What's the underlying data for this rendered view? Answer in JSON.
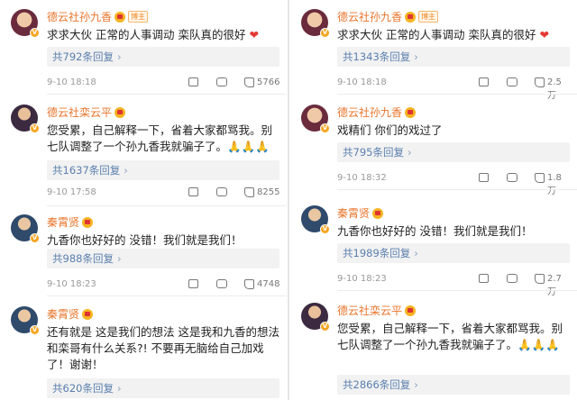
{
  "left": [
    {
      "name": "德云社孙九香",
      "badge": "博主",
      "text": "求求大伙 正常的人事调动 栾队真的很好",
      "emoji": "❤",
      "replies": "共792条回复",
      "time": "9-10 18:18",
      "likes": "5766"
    },
    {
      "name": "德云社栾云平",
      "text": "您受累，自己解释一下，省着大家都骂我。别七队调整了一个孙九香我就骗子了。🙏🙏🙏",
      "replies": "共1637条回复",
      "time": "9-10 17:58",
      "likes": "8255"
    },
    {
      "name": "秦霄贤",
      "text": "九香你也好好的   没错！我们就是我们！",
      "replies": "共988条回复",
      "time": "9-10 18:23",
      "likes": "4748"
    },
    {
      "name": "秦霄贤",
      "text": "还有就是 这是我们的想法   这是我和九香的想法   和栾哥有什么关系?! 不要再无脑给自己加戏了！谢谢！",
      "replies": "共620条回复"
    }
  ],
  "right": [
    {
      "name": "德云社孙九香",
      "badge": "博主",
      "text": "求求大伙 正常的人事调动 栾队真的很好",
      "emoji": "❤",
      "replies": "共1343条回复",
      "time": "9-10 18:18",
      "likes": "2.5万"
    },
    {
      "name": "德云社孙九香",
      "text": "戏精们 你们的戏过了",
      "replies": "共795条回复",
      "time": "9-10 18:32",
      "likes": "1.8万"
    },
    {
      "name": "秦霄贤",
      "text": "九香你也好好的   没错！我们就是我们！",
      "replies": "共1989条回复",
      "time": "9-10 18:23",
      "likes": "2.7万"
    },
    {
      "name": "德云社栾云平",
      "text": "您受累，自己解释一下，省着大家都骂我。别七队调整了一个孙九香我就骗子了。🙏🙏🙏",
      "replies": "共2866条回复"
    }
  ],
  "ui": {
    "chevron": "›",
    "v_mark": "V",
    "share_icon": "share-icon",
    "comment_icon": "comment-icon",
    "like_icon": "thumb-up-icon"
  },
  "colors": {
    "name": "#e8742a",
    "reply_link": "#5b7fae",
    "heart": "#e53935"
  }
}
